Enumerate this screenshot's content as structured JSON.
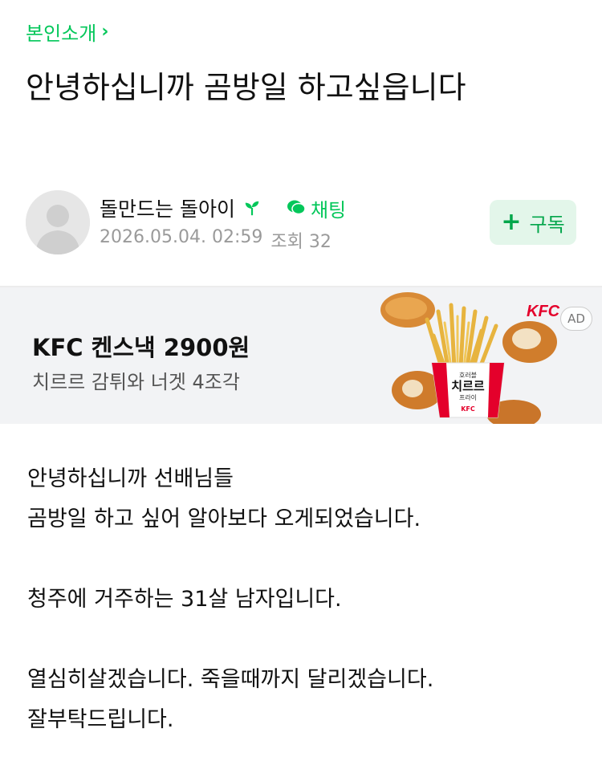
{
  "board": {
    "label": "본인소개"
  },
  "post": {
    "title": "안녕하십니까 곰방일 하고싶읍니다",
    "author": "돌만드는 돌아이",
    "chat_label": "채팅",
    "date": "2026.05.04. 02:59",
    "views": "조회 32",
    "subscribe_label": "구독"
  },
  "ad": {
    "title": "KFC 켄스낵 2900원",
    "subtitle": "치르르 감튀와 너겟 4조각",
    "brand": "KFC",
    "badge": "AD",
    "box_text_1": "호러블",
    "box_text_2": "치르르",
    "box_text_3": "프라이",
    "box_brand": "KFC"
  },
  "body": {
    "lines": [
      "안녕하십니까 선배님들",
      "곰방일 하고 싶어 알아보다 오게되었습니다.",
      "",
      "청주에 거주하는 31살 남자입니다.",
      "",
      "열심히살겠습니다. 죽을때까지 달리겠습니다.",
      "잘부탁드립니다."
    ]
  },
  "colors": {
    "accent": "#03c75a",
    "kfc_red": "#e4002b"
  },
  "icons": [
    "chevron-right-icon",
    "sprout-icon",
    "chat-bubble-icon",
    "plus-icon",
    "avatar-placeholder-icon"
  ]
}
